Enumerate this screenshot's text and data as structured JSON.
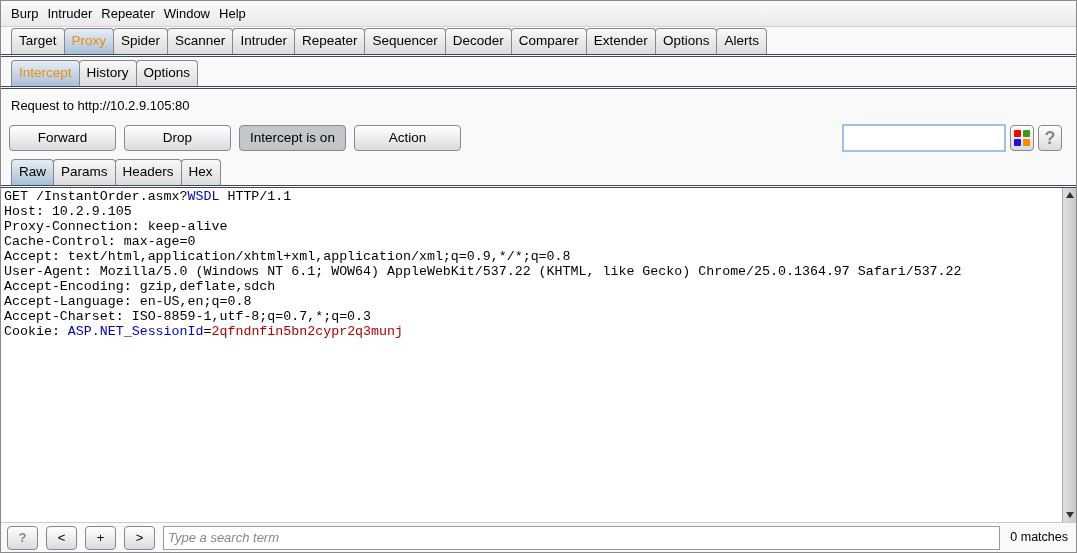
{
  "menu": [
    "Burp",
    "Intruder",
    "Repeater",
    "Window",
    "Help"
  ],
  "tabs": [
    {
      "label": "Target",
      "selected": false
    },
    {
      "label": "Proxy",
      "selected": true
    },
    {
      "label": "Spider",
      "selected": false
    },
    {
      "label": "Scanner",
      "selected": false
    },
    {
      "label": "Intruder",
      "selected": false
    },
    {
      "label": "Repeater",
      "selected": false
    },
    {
      "label": "Sequencer",
      "selected": false
    },
    {
      "label": "Decoder",
      "selected": false
    },
    {
      "label": "Comparer",
      "selected": false
    },
    {
      "label": "Extender",
      "selected": false
    },
    {
      "label": "Options",
      "selected": false
    },
    {
      "label": "Alerts",
      "selected": false
    }
  ],
  "subtabs": [
    {
      "label": "Intercept",
      "selected": true
    },
    {
      "label": "History",
      "selected": false
    },
    {
      "label": "Options",
      "selected": false
    }
  ],
  "request_label": "Request to http://10.2.9.105:80",
  "top_help": "?",
  "buttons": [
    {
      "label": "Forward",
      "pressed": false
    },
    {
      "label": "Drop",
      "pressed": false
    },
    {
      "label": "Intercept is on",
      "pressed": true
    },
    {
      "label": "Action",
      "pressed": false
    }
  ],
  "view_tabs": [
    {
      "label": "Raw",
      "selected": true
    },
    {
      "label": "Params",
      "selected": false
    },
    {
      "label": "Headers",
      "selected": false
    },
    {
      "label": "Hex",
      "selected": false
    }
  ],
  "request_lines": [
    [
      {
        "kind": "text",
        "text": "GET /InstantOrder.asmx?"
      },
      {
        "kind": "param_name",
        "text": "WSDL"
      },
      {
        "kind": "text",
        "text": " HTTP/1.1"
      }
    ],
    [
      {
        "kind": "text",
        "text": "Host: 10.2.9.105"
      }
    ],
    [
      {
        "kind": "text",
        "text": "Proxy-Connection: keep-alive"
      }
    ],
    [
      {
        "kind": "text",
        "text": "Cache-Control: max-age=0"
      }
    ],
    [
      {
        "kind": "text",
        "text": "Accept: text/html,application/xhtml+xml,application/xml;q=0.9,*/*;q=0.8"
      }
    ],
    [
      {
        "kind": "text",
        "text": "User-Agent: Mozilla/5.0 (Windows NT 6.1; WOW64) AppleWebKit/537.22 (KHTML, like Gecko) Chrome/25.0.1364.97 Safari/537.22"
      }
    ],
    [
      {
        "kind": "text",
        "text": "Accept-Encoding: gzip,deflate,sdch"
      }
    ],
    [
      {
        "kind": "text",
        "text": "Accept-Language: en-US,en;q=0.8"
      }
    ],
    [
      {
        "kind": "text",
        "text": "Accept-Charset: ISO-8859-1,utf-8;q=0.7,*;q=0.3"
      }
    ],
    [
      {
        "kind": "text",
        "text": "Cookie: "
      },
      {
        "kind": "param_name",
        "text": "ASP.NET_SessionId"
      },
      {
        "kind": "text",
        "text": "="
      },
      {
        "kind": "param_value",
        "text": "2qfndnfin5bn2cypr2q3munj"
      }
    ]
  ],
  "footer": {
    "help": "?",
    "prev": "<",
    "add": "+",
    "next": ">",
    "search_placeholder": "Type a search term",
    "matches": "0 matches"
  }
}
